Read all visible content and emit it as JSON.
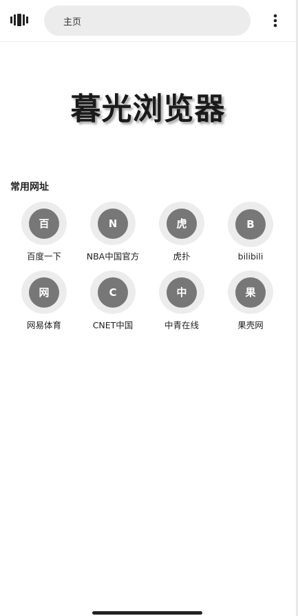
{
  "topbar": {
    "tabs_icon": "tabs-icon",
    "address": "主页",
    "menu_icon": "more-vertical-icon"
  },
  "brand_title": "暮光浏览器",
  "section_label": "常用网址",
  "sites": [
    {
      "letter": "百",
      "name": "百度一下"
    },
    {
      "letter": "N",
      "name": "NBA中国官方"
    },
    {
      "letter": "虎",
      "name": "虎扑"
    },
    {
      "letter": "B",
      "name": "bilibili"
    },
    {
      "letter": "网",
      "name": "网易体育"
    },
    {
      "letter": "C",
      "name": "CNET中国"
    },
    {
      "letter": "中",
      "name": "中青在线"
    },
    {
      "letter": "果",
      "name": "果壳网"
    }
  ],
  "colors": {
    "site_circle": "#777777",
    "ring": "#ececec",
    "address_bar": "#ececec"
  }
}
